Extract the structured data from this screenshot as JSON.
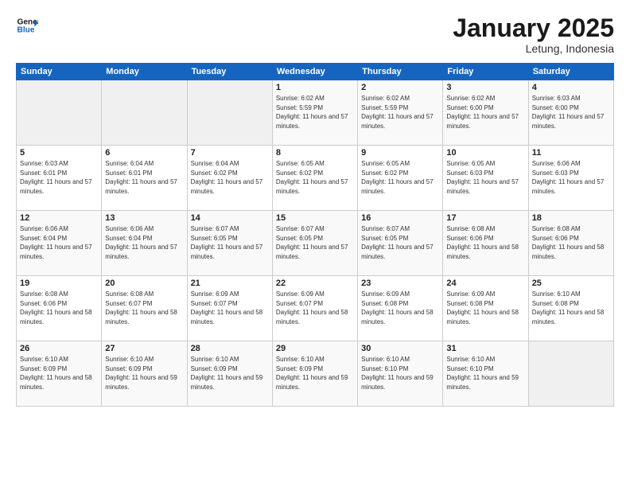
{
  "logo": {
    "line1": "General",
    "line2": "Blue"
  },
  "title": "January 2025",
  "subtitle": "Letung, Indonesia",
  "days_of_week": [
    "Sunday",
    "Monday",
    "Tuesday",
    "Wednesday",
    "Thursday",
    "Friday",
    "Saturday"
  ],
  "weeks": [
    [
      {
        "day": "",
        "sunrise": "",
        "sunset": "",
        "daylight": "",
        "empty": true
      },
      {
        "day": "",
        "sunrise": "",
        "sunset": "",
        "daylight": "",
        "empty": true
      },
      {
        "day": "",
        "sunrise": "",
        "sunset": "",
        "daylight": "",
        "empty": true
      },
      {
        "day": "1",
        "sunrise": "Sunrise: 6:02 AM",
        "sunset": "Sunset: 5:59 PM",
        "daylight": "Daylight: 11 hours and 57 minutes."
      },
      {
        "day": "2",
        "sunrise": "Sunrise: 6:02 AM",
        "sunset": "Sunset: 5:59 PM",
        "daylight": "Daylight: 11 hours and 57 minutes."
      },
      {
        "day": "3",
        "sunrise": "Sunrise: 6:02 AM",
        "sunset": "Sunset: 6:00 PM",
        "daylight": "Daylight: 11 hours and 57 minutes."
      },
      {
        "day": "4",
        "sunrise": "Sunrise: 6:03 AM",
        "sunset": "Sunset: 6:00 PM",
        "daylight": "Daylight: 11 hours and 57 minutes."
      }
    ],
    [
      {
        "day": "5",
        "sunrise": "Sunrise: 6:03 AM",
        "sunset": "Sunset: 6:01 PM",
        "daylight": "Daylight: 11 hours and 57 minutes."
      },
      {
        "day": "6",
        "sunrise": "Sunrise: 6:04 AM",
        "sunset": "Sunset: 6:01 PM",
        "daylight": "Daylight: 11 hours and 57 minutes."
      },
      {
        "day": "7",
        "sunrise": "Sunrise: 6:04 AM",
        "sunset": "Sunset: 6:02 PM",
        "daylight": "Daylight: 11 hours and 57 minutes."
      },
      {
        "day": "8",
        "sunrise": "Sunrise: 6:05 AM",
        "sunset": "Sunset: 6:02 PM",
        "daylight": "Daylight: 11 hours and 57 minutes."
      },
      {
        "day": "9",
        "sunrise": "Sunrise: 6:05 AM",
        "sunset": "Sunset: 6:02 PM",
        "daylight": "Daylight: 11 hours and 57 minutes."
      },
      {
        "day": "10",
        "sunrise": "Sunrise: 6:05 AM",
        "sunset": "Sunset: 6:03 PM",
        "daylight": "Daylight: 11 hours and 57 minutes."
      },
      {
        "day": "11",
        "sunrise": "Sunrise: 6:06 AM",
        "sunset": "Sunset: 6:03 PM",
        "daylight": "Daylight: 11 hours and 57 minutes."
      }
    ],
    [
      {
        "day": "12",
        "sunrise": "Sunrise: 6:06 AM",
        "sunset": "Sunset: 6:04 PM",
        "daylight": "Daylight: 11 hours and 57 minutes."
      },
      {
        "day": "13",
        "sunrise": "Sunrise: 6:06 AM",
        "sunset": "Sunset: 6:04 PM",
        "daylight": "Daylight: 11 hours and 57 minutes."
      },
      {
        "day": "14",
        "sunrise": "Sunrise: 6:07 AM",
        "sunset": "Sunset: 6:05 PM",
        "daylight": "Daylight: 11 hours and 57 minutes."
      },
      {
        "day": "15",
        "sunrise": "Sunrise: 6:07 AM",
        "sunset": "Sunset: 6:05 PM",
        "daylight": "Daylight: 11 hours and 57 minutes."
      },
      {
        "day": "16",
        "sunrise": "Sunrise: 6:07 AM",
        "sunset": "Sunset: 6:05 PM",
        "daylight": "Daylight: 11 hours and 57 minutes."
      },
      {
        "day": "17",
        "sunrise": "Sunrise: 6:08 AM",
        "sunset": "Sunset: 6:06 PM",
        "daylight": "Daylight: 11 hours and 58 minutes."
      },
      {
        "day": "18",
        "sunrise": "Sunrise: 6:08 AM",
        "sunset": "Sunset: 6:06 PM",
        "daylight": "Daylight: 11 hours and 58 minutes."
      }
    ],
    [
      {
        "day": "19",
        "sunrise": "Sunrise: 6:08 AM",
        "sunset": "Sunset: 6:06 PM",
        "daylight": "Daylight: 11 hours and 58 minutes."
      },
      {
        "day": "20",
        "sunrise": "Sunrise: 6:08 AM",
        "sunset": "Sunset: 6:07 PM",
        "daylight": "Daylight: 11 hours and 58 minutes."
      },
      {
        "day": "21",
        "sunrise": "Sunrise: 6:09 AM",
        "sunset": "Sunset: 6:07 PM",
        "daylight": "Daylight: 11 hours and 58 minutes."
      },
      {
        "day": "22",
        "sunrise": "Sunrise: 6:09 AM",
        "sunset": "Sunset: 6:07 PM",
        "daylight": "Daylight: 11 hours and 58 minutes."
      },
      {
        "day": "23",
        "sunrise": "Sunrise: 6:09 AM",
        "sunset": "Sunset: 6:08 PM",
        "daylight": "Daylight: 11 hours and 58 minutes."
      },
      {
        "day": "24",
        "sunrise": "Sunrise: 6:09 AM",
        "sunset": "Sunset: 6:08 PM",
        "daylight": "Daylight: 11 hours and 58 minutes."
      },
      {
        "day": "25",
        "sunrise": "Sunrise: 6:10 AM",
        "sunset": "Sunset: 6:08 PM",
        "daylight": "Daylight: 11 hours and 58 minutes."
      }
    ],
    [
      {
        "day": "26",
        "sunrise": "Sunrise: 6:10 AM",
        "sunset": "Sunset: 6:09 PM",
        "daylight": "Daylight: 11 hours and 58 minutes."
      },
      {
        "day": "27",
        "sunrise": "Sunrise: 6:10 AM",
        "sunset": "Sunset: 6:09 PM",
        "daylight": "Daylight: 11 hours and 59 minutes."
      },
      {
        "day": "28",
        "sunrise": "Sunrise: 6:10 AM",
        "sunset": "Sunset: 6:09 PM",
        "daylight": "Daylight: 11 hours and 59 minutes."
      },
      {
        "day": "29",
        "sunrise": "Sunrise: 6:10 AM",
        "sunset": "Sunset: 6:09 PM",
        "daylight": "Daylight: 11 hours and 59 minutes."
      },
      {
        "day": "30",
        "sunrise": "Sunrise: 6:10 AM",
        "sunset": "Sunset: 6:10 PM",
        "daylight": "Daylight: 11 hours and 59 minutes."
      },
      {
        "day": "31",
        "sunrise": "Sunrise: 6:10 AM",
        "sunset": "Sunset: 6:10 PM",
        "daylight": "Daylight: 11 hours and 59 minutes."
      },
      {
        "day": "",
        "sunrise": "",
        "sunset": "",
        "daylight": "",
        "empty": true
      }
    ]
  ]
}
